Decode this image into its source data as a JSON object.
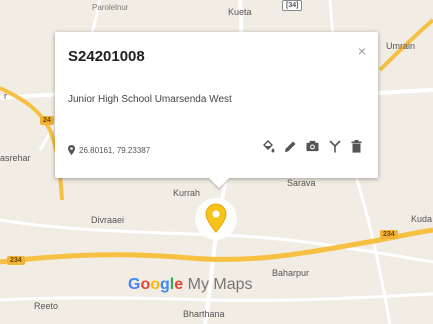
{
  "popup": {
    "title": "S24201008",
    "close_label": "×",
    "description": "Junior High School Umarsenda West",
    "coordinates": "26.80161, 79.23387"
  },
  "map_labels": {
    "kueta": "Kueta",
    "umrain": "Umrain",
    "kurrah": "Kurrah",
    "sarava": "Sarava",
    "divraaei": "Divraaei",
    "kuda": "Kuda",
    "baharpur": "Baharpur",
    "reeto": "Reeto",
    "bharthana": "Bharthana",
    "mrehar": "asrehar",
    "left_r": "r",
    "partial_top": "Parolelnur"
  },
  "road_shields": {
    "s1": "234",
    "s2": "234",
    "s3": "234",
    "s4": "24",
    "s5": "[34]"
  },
  "branding": {
    "google": [
      "G",
      "o",
      "o",
      "g",
      "l",
      "e"
    ],
    "my_maps": "My Maps"
  },
  "colors": {
    "marker": "#f6c31a",
    "road_major": "#f6c042",
    "road_minor": "#ffffff",
    "land": "#f1ede4"
  }
}
